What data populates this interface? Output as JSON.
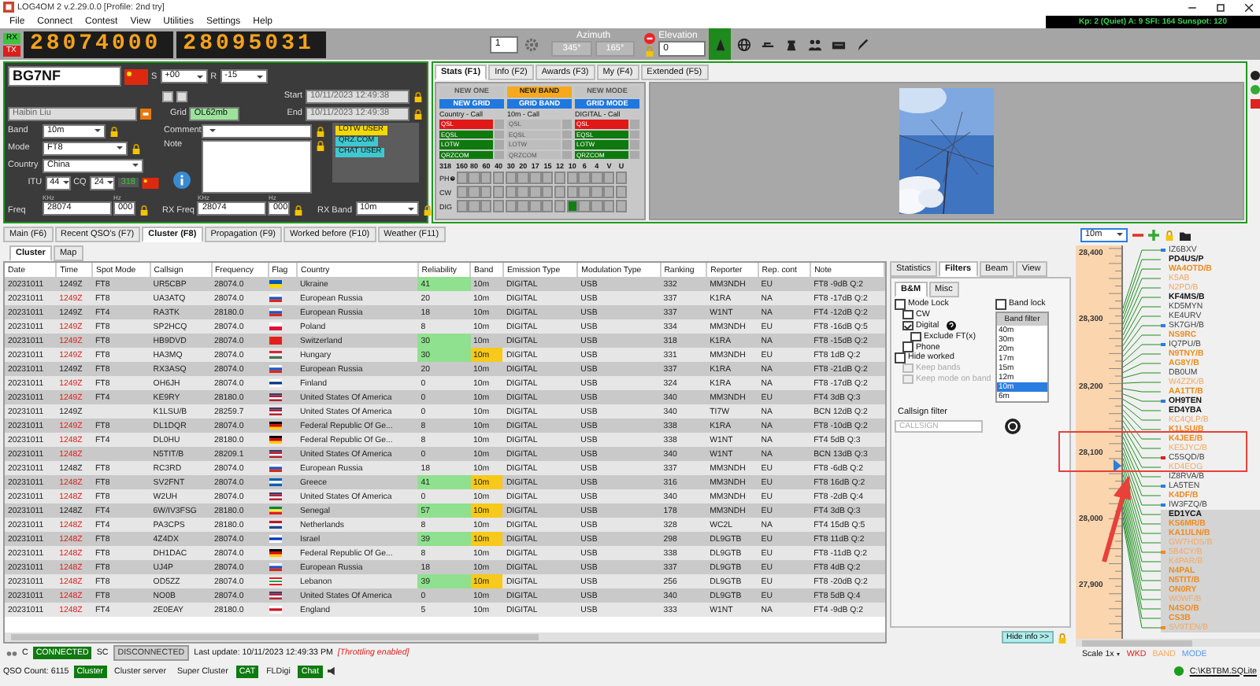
{
  "window": {
    "title": "LOG4OM 2 v.2.29.0.0 [Profile: 2nd try]"
  },
  "menu": [
    "File",
    "Connect",
    "Contest",
    "View",
    "Utilities",
    "Settings",
    "Help"
  ],
  "solar": "Kp: 2 (Quiet)  A: 9  SFI: 164  Sunspot: 120",
  "radio": {
    "rx": "RX",
    "tx": "TX",
    "vfo_a": "28074000",
    "vfo_b": "28095031",
    "spin": "1",
    "azimuth_label": "Azimuth",
    "azimuth": [
      "345°",
      "165°"
    ],
    "elevation_label": "Elevation",
    "elevation": "0"
  },
  "entry": {
    "callsign": "BG7NF",
    "s_label": "S",
    "s_value": "+00",
    "r_label": "R",
    "r_value": "-15",
    "name": "Haibin Liu",
    "grid_label": "Grid",
    "grid": "OL62mb",
    "start_label": "Start",
    "start": "10/11/2023 12:49:38",
    "end_label": "End",
    "end": "10/11/2023 12:49:38",
    "band_label": "Band",
    "band": "10m",
    "mode_label": "Mode",
    "mode": "FT8",
    "country_label": "Country",
    "country": "China",
    "itu_label": "ITU",
    "itu": "44",
    "cq_label": "CQ",
    "cq": "24",
    "dxcc": "318",
    "comment_label": "Comment",
    "note_label": "Note",
    "tags": [
      {
        "label": "LOTW USER",
        "color": "#f5d800"
      },
      {
        "label": "QRZ.COM",
        "color": "#40c8d0"
      },
      {
        "label": "CHAT USER",
        "color": "#40c8d0"
      }
    ],
    "khz": "KHz",
    "hz": "Hz",
    "freq_label": "Freq",
    "freq": "28074",
    "freq_hz": "000",
    "rx_khz": "KHz",
    "rx_hz": "Hz",
    "rx_freq_label": "RX Freq",
    "rx_freq": "28074",
    "rx_freq_hz": "000",
    "rx_band_label": "RX Band",
    "rx_band": "10m"
  },
  "stats": {
    "tabs": [
      {
        "label": "Stats (F1)",
        "selected": true
      },
      {
        "label": "Info (F2)",
        "selected": false
      },
      {
        "label": "Awards (F3)",
        "selected": false
      },
      {
        "label": "My (F4)",
        "selected": false
      },
      {
        "label": "Extended (F5)",
        "selected": false
      }
    ],
    "alerts": [
      {
        "label": "NEW ONE",
        "on": false
      },
      {
        "label": "NEW BAND",
        "on": true
      },
      {
        "label": "NEW MODE",
        "on": false
      }
    ],
    "grid_alerts": [
      {
        "label": "NEW GRID",
        "on": true
      },
      {
        "label": "GRID BAND",
        "on": true
      },
      {
        "label": "GRID MODE",
        "on": true
      }
    ],
    "columns": [
      {
        "title": "Country - Call",
        "items": [
          {
            "label": "QSL",
            "confirmed": false,
            "disabled": false
          },
          {
            "label": "EQSL",
            "confirmed": true,
            "disabled": false
          },
          {
            "label": "LOTW",
            "confirmed": true,
            "disabled": false
          },
          {
            "label": "QRZCOM",
            "confirmed": true,
            "disabled": false
          }
        ]
      },
      {
        "title": "10m - Call",
        "items": [
          {
            "label": "QSL",
            "disabled": true
          },
          {
            "label": "EQSL",
            "disabled": true
          },
          {
            "label": "LOTW",
            "disabled": true
          },
          {
            "label": "QRZCOM",
            "disabled": true
          }
        ]
      },
      {
        "title": "DIGITAL - Call",
        "items": [
          {
            "label": "QSL",
            "confirmed": false,
            "disabled": false
          },
          {
            "label": "EQSL",
            "confirmed": true,
            "disabled": false
          },
          {
            "label": "LOTW",
            "confirmed": true,
            "disabled": false
          },
          {
            "label": "QRZCOM",
            "confirmed": true,
            "disabled": false
          }
        ]
      }
    ],
    "count": "318",
    "bands": [
      "160",
      "80",
      "60",
      "40",
      "30",
      "20",
      "17",
      "15",
      "12",
      "10",
      "6",
      "4",
      "V",
      "U"
    ],
    "modes": [
      {
        "label": "PH",
        "cells": [
          false,
          false,
          false,
          false,
          false,
          false,
          false,
          false,
          false,
          false,
          false,
          false,
          false,
          false
        ]
      },
      {
        "label": "CW",
        "cells": [
          false,
          false,
          false,
          false,
          false,
          false,
          false,
          false,
          false,
          false,
          false,
          false,
          false,
          false
        ]
      },
      {
        "label": "DIG",
        "cells": [
          false,
          false,
          false,
          false,
          false,
          false,
          false,
          false,
          false,
          true,
          false,
          false,
          false,
          false
        ]
      }
    ]
  },
  "main_tabs": [
    {
      "label": "Main (F6)",
      "selected": false
    },
    {
      "label": "Recent QSO's (F7)",
      "selected": false
    },
    {
      "label": "Cluster (F8)",
      "selected": true
    },
    {
      "label": "Propagation (F9)",
      "selected": false
    },
    {
      "label": "Worked before (F10)",
      "selected": false
    },
    {
      "label": "Weather (F11)",
      "selected": false
    }
  ],
  "sub_tabs": [
    {
      "label": "Cluster",
      "selected": true
    },
    {
      "label": "Map",
      "selected": false
    }
  ],
  "table": {
    "columns": [
      "Date",
      "Time",
      "Spot Mode",
      "Callsign",
      "Frequency",
      "Flag",
      "Country",
      "Reliability",
      "Band",
      "Emission Type",
      "Modulation Type",
      "Ranking",
      "Reporter",
      "Rep. cont",
      "Note"
    ],
    "rows": [
      {
        "date": "20231011",
        "time": "1249Z",
        "time_new": false,
        "mode": "FT8",
        "call": "UR5CBP",
        "freq": "28074.0",
        "flag": [
          {
            "color": "#0057b7"
          },
          {
            "color": "#ffd700"
          }
        ],
        "country": "Ukraine",
        "rel": "41",
        "reliable": true,
        "band": "10m",
        "band_new": false,
        "emission": "DIGITAL",
        "modulation": "USB",
        "rank": "332",
        "reporter": "MM3NDH",
        "cont": "EU",
        "note": "FT8 -9dB Q:2"
      },
      {
        "date": "20231011",
        "time": "1249Z",
        "time_new": true,
        "mode": "FT8",
        "call": "UA3ATQ",
        "freq": "28074.0",
        "flag": [
          {
            "color": "#ffffff"
          },
          {
            "color": "#1c57c8"
          },
          {
            "color": "#d52b1e"
          }
        ],
        "country": "European Russia",
        "rel": "20",
        "reliable": false,
        "band": "10m",
        "band_new": false,
        "emission": "DIGITAL",
        "modulation": "USB",
        "rank": "337",
        "reporter": "K1RA",
        "cont": "NA",
        "note": "FT8 -17dB Q:2"
      },
      {
        "date": "20231011",
        "time": "1249Z",
        "time_new": false,
        "mode": "FT4",
        "call": "RA3TK",
        "freq": "28180.0",
        "flag": [
          {
            "color": "#ffffff"
          },
          {
            "color": "#1c57c8"
          },
          {
            "color": "#d52b1e"
          }
        ],
        "country": "European Russia",
        "rel": "18",
        "reliable": false,
        "band": "10m",
        "band_new": false,
        "emission": "DIGITAL",
        "modulation": "USB",
        "rank": "337",
        "reporter": "W1NT",
        "cont": "NA",
        "note": "FT4 -12dB Q:2"
      },
      {
        "date": "20231011",
        "time": "1249Z",
        "time_new": true,
        "mode": "FT8",
        "call": "SP2HCQ",
        "freq": "28074.0",
        "flag": [
          {
            "color": "#ffffff"
          },
          {
            "color": "#dc143c"
          }
        ],
        "country": "Poland",
        "rel": "8",
        "reliable": false,
        "band": "10m",
        "band_new": false,
        "emission": "DIGITAL",
        "modulation": "USB",
        "rank": "334",
        "reporter": "MM3NDH",
        "cont": "EU",
        "note": "FT8 -16dB Q:5"
      },
      {
        "date": "20231011",
        "time": "1249Z",
        "time_new": true,
        "mode": "FT8",
        "call": "HB9DVD",
        "freq": "28074.0",
        "flag": [
          {
            "color": "#e2211c"
          }
        ],
        "country": "Switzerland",
        "rel": "30",
        "reliable": true,
        "band": "10m",
        "band_new": false,
        "emission": "DIGITAL",
        "modulation": "USB",
        "rank": "318",
        "reporter": "K1RA",
        "cont": "NA",
        "note": "FT8 -15dB Q:2"
      },
      {
        "date": "20231011",
        "time": "1249Z",
        "time_new": true,
        "mode": "FT8",
        "call": "HA3MQ",
        "freq": "28074.0",
        "flag": [
          {
            "color": "#ce2939"
          },
          {
            "color": "#ffffff"
          },
          {
            "color": "#477050"
          }
        ],
        "country": "Hungary",
        "rel": "30",
        "reliable": true,
        "band": "10m",
        "band_new": true,
        "emission": "DIGITAL",
        "modulation": "USB",
        "rank": "331",
        "reporter": "MM3NDH",
        "cont": "EU",
        "note": "FT8 1dB Q:2"
      },
      {
        "date": "20231011",
        "time": "1249Z",
        "time_new": false,
        "mode": "FT8",
        "call": "RX3ASQ",
        "freq": "28074.0",
        "flag": [
          {
            "color": "#ffffff"
          },
          {
            "color": "#1c57c8"
          },
          {
            "color": "#d52b1e"
          }
        ],
        "country": "European Russia",
        "rel": "20",
        "reliable": false,
        "band": "10m",
        "band_new": false,
        "emission": "DIGITAL",
        "modulation": "USB",
        "rank": "337",
        "reporter": "K1RA",
        "cont": "NA",
        "note": "FT8 -21dB Q:2"
      },
      {
        "date": "20231011",
        "time": "1249Z",
        "time_new": true,
        "mode": "FT8",
        "call": "OH6JH",
        "freq": "28074.0",
        "flag": [
          {
            "color": "#ffffff"
          },
          {
            "color": "#003580"
          },
          {
            "color": "#ffffff"
          }
        ],
        "country": "Finland",
        "rel": "0",
        "reliable": false,
        "band": "10m",
        "band_new": false,
        "emission": "DIGITAL",
        "modulation": "USB",
        "rank": "324",
        "reporter": "K1RA",
        "cont": "NA",
        "note": "FT8 -17dB Q:2"
      },
      {
        "date": "20231011",
        "time": "1249Z",
        "time_new": true,
        "mode": "FT4",
        "call": "KE9RY",
        "freq": "28180.0",
        "flag": [
          {
            "color": "#3c3b6e"
          },
          {
            "color": "#b22234"
          },
          {
            "color": "#ffffff"
          },
          {
            "color": "#b22234"
          }
        ],
        "country": "United States Of America",
        "rel": "0",
        "reliable": false,
        "band": "10m",
        "band_new": false,
        "emission": "DIGITAL",
        "modulation": "USB",
        "rank": "340",
        "reporter": "MM3NDH",
        "cont": "EU",
        "note": "FT4 3dB Q:3"
      },
      {
        "date": "20231011",
        "time": "1249Z",
        "time_new": false,
        "mode": "",
        "call": "K1LSU/B",
        "freq": "28259.7",
        "flag": [
          {
            "color": "#3c3b6e"
          },
          {
            "color": "#b22234"
          },
          {
            "color": "#ffffff"
          },
          {
            "color": "#b22234"
          }
        ],
        "country": "United States Of America",
        "rel": "0",
        "reliable": false,
        "band": "10m",
        "band_new": false,
        "emission": "DIGITAL",
        "modulation": "USB",
        "rank": "340",
        "reporter": "TI7W",
        "cont": "NA",
        "note": "BCN 12dB Q:2"
      },
      {
        "date": "20231011",
        "time": "1249Z",
        "time_new": true,
        "mode": "FT8",
        "call": "DL1DQR",
        "freq": "28074.0",
        "flag": [
          {
            "color": "#000000"
          },
          {
            "color": "#dd0000"
          },
          {
            "color": "#ffce00"
          }
        ],
        "country": "Federal Republic Of Ge...",
        "rel": "8",
        "reliable": false,
        "band": "10m",
        "band_new": false,
        "emission": "DIGITAL",
        "modulation": "USB",
        "rank": "338",
        "reporter": "K1RA",
        "cont": "NA",
        "note": "FT8 -10dB Q:2"
      },
      {
        "date": "20231011",
        "time": "1248Z",
        "time_new": true,
        "mode": "FT4",
        "call": "DL0HU",
        "freq": "28180.0",
        "flag": [
          {
            "color": "#000000"
          },
          {
            "color": "#dd0000"
          },
          {
            "color": "#ffce00"
          }
        ],
        "country": "Federal Republic Of Ge...",
        "rel": "8",
        "reliable": false,
        "band": "10m",
        "band_new": false,
        "emission": "DIGITAL",
        "modulation": "USB",
        "rank": "338",
        "reporter": "W1NT",
        "cont": "NA",
        "note": "FT4 5dB Q:3"
      },
      {
        "date": "20231011",
        "time": "1248Z",
        "time_new": true,
        "mode": "",
        "call": "N5TIT/B",
        "freq": "28209.1",
        "flag": [
          {
            "color": "#3c3b6e"
          },
          {
            "color": "#b22234"
          },
          {
            "color": "#ffffff"
          },
          {
            "color": "#b22234"
          }
        ],
        "country": "United States Of America",
        "rel": "0",
        "reliable": false,
        "band": "10m",
        "band_new": false,
        "emission": "DIGITAL",
        "modulation": "USB",
        "rank": "340",
        "reporter": "W1NT",
        "cont": "NA",
        "note": "BCN 13dB Q:3"
      },
      {
        "date": "20231011",
        "time": "1248Z",
        "time_new": false,
        "mode": "FT8",
        "call": "RC3RD",
        "freq": "28074.0",
        "flag": [
          {
            "color": "#ffffff"
          },
          {
            "color": "#1c57c8"
          },
          {
            "color": "#d52b1e"
          }
        ],
        "country": "European Russia",
        "rel": "18",
        "reliable": false,
        "band": "10m",
        "band_new": false,
        "emission": "DIGITAL",
        "modulation": "USB",
        "rank": "337",
        "reporter": "MM3NDH",
        "cont": "EU",
        "note": "FT8 -6dB Q:2"
      },
      {
        "date": "20231011",
        "time": "1248Z",
        "time_new": true,
        "mode": "FT8",
        "call": "SV2FNT",
        "freq": "28074.0",
        "flag": [
          {
            "color": "#0d5eaf"
          },
          {
            "color": "#ffffff"
          },
          {
            "color": "#0d5eaf"
          }
        ],
        "country": "Greece",
        "rel": "41",
        "reliable": true,
        "band": "10m",
        "band_new": true,
        "emission": "DIGITAL",
        "modulation": "USB",
        "rank": "316",
        "reporter": "MM3NDH",
        "cont": "EU",
        "note": "FT8 16dB Q:2"
      },
      {
        "date": "20231011",
        "time": "1248Z",
        "time_new": true,
        "mode": "FT8",
        "call": "W2UH",
        "freq": "28074.0",
        "flag": [
          {
            "color": "#3c3b6e"
          },
          {
            "color": "#b22234"
          },
          {
            "color": "#ffffff"
          },
          {
            "color": "#b22234"
          }
        ],
        "country": "United States Of America",
        "rel": "0",
        "reliable": false,
        "band": "10m",
        "band_new": false,
        "emission": "DIGITAL",
        "modulation": "USB",
        "rank": "340",
        "reporter": "MM3NDH",
        "cont": "EU",
        "note": "FT8 -2dB Q:4"
      },
      {
        "date": "20231011",
        "time": "1248Z",
        "time_new": false,
        "mode": "FT4",
        "call": "6W/IV3FSG",
        "freq": "28180.0",
        "flag": [
          {
            "color": "#00853f"
          },
          {
            "color": "#fdef42"
          },
          {
            "color": "#e31b23"
          }
        ],
        "country": "Senegal",
        "rel": "57",
        "reliable": true,
        "band": "10m",
        "band_new": true,
        "emission": "DIGITAL",
        "modulation": "USB",
        "rank": "178",
        "reporter": "MM3NDH",
        "cont": "EU",
        "note": "FT4 3dB Q:3"
      },
      {
        "date": "20231011",
        "time": "1248Z",
        "time_new": true,
        "mode": "FT4",
        "call": "PA3CPS",
        "freq": "28180.0",
        "flag": [
          {
            "color": "#ae1c28"
          },
          {
            "color": "#ffffff"
          },
          {
            "color": "#21468b"
          }
        ],
        "country": "Netherlands",
        "rel": "8",
        "reliable": false,
        "band": "10m",
        "band_new": false,
        "emission": "DIGITAL",
        "modulation": "USB",
        "rank": "328",
        "reporter": "WC2L",
        "cont": "NA",
        "note": "FT4 15dB Q:5"
      },
      {
        "date": "20231011",
        "time": "1248Z",
        "time_new": true,
        "mode": "FT8",
        "call": "4Z4DX",
        "freq": "28074.0",
        "flag": [
          {
            "color": "#ffffff"
          },
          {
            "color": "#0038b8"
          },
          {
            "color": "#ffffff"
          }
        ],
        "country": "Israel",
        "rel": "39",
        "reliable": true,
        "band": "10m",
        "band_new": true,
        "emission": "DIGITAL",
        "modulation": "USB",
        "rank": "298",
        "reporter": "DL9GTB",
        "cont": "EU",
        "note": "FT8 11dB Q:2"
      },
      {
        "date": "20231011",
        "time": "1248Z",
        "time_new": true,
        "mode": "FT8",
        "call": "DH1DAC",
        "freq": "28074.0",
        "flag": [
          {
            "color": "#000000"
          },
          {
            "color": "#dd0000"
          },
          {
            "color": "#ffce00"
          }
        ],
        "country": "Federal Republic Of Ge...",
        "rel": "8",
        "reliable": false,
        "band": "10m",
        "band_new": false,
        "emission": "DIGITAL",
        "modulation": "USB",
        "rank": "338",
        "reporter": "DL9GTB",
        "cont": "EU",
        "note": "FT8 -11dB Q:2"
      },
      {
        "date": "20231011",
        "time": "1248Z",
        "time_new": true,
        "mode": "FT8",
        "call": "UJ4P",
        "freq": "28074.0",
        "flag": [
          {
            "color": "#ffffff"
          },
          {
            "color": "#1c57c8"
          },
          {
            "color": "#d52b1e"
          }
        ],
        "country": "European Russia",
        "rel": "18",
        "reliable": false,
        "band": "10m",
        "band_new": false,
        "emission": "DIGITAL",
        "modulation": "USB",
        "rank": "337",
        "reporter": "DL9GTB",
        "cont": "EU",
        "note": "FT8 4dB Q:2"
      },
      {
        "date": "20231011",
        "time": "1248Z",
        "time_new": true,
        "mode": "FT8",
        "call": "OD5ZZ",
        "freq": "28074.0",
        "flag": [
          {
            "color": "#ee161f"
          },
          {
            "color": "#ffffff"
          },
          {
            "color": "#00a651"
          },
          {
            "color": "#ffffff"
          },
          {
            "color": "#ee161f"
          }
        ],
        "country": "Lebanon",
        "rel": "39",
        "reliable": true,
        "band": "10m",
        "band_new": true,
        "emission": "DIGITAL",
        "modulation": "USB",
        "rank": "256",
        "reporter": "DL9GTB",
        "cont": "EU",
        "note": "FT8 -20dB Q:2"
      },
      {
        "date": "20231011",
        "time": "1248Z",
        "time_new": true,
        "mode": "FT8",
        "call": "NO0B",
        "freq": "28074.0",
        "flag": [
          {
            "color": "#3c3b6e"
          },
          {
            "color": "#b22234"
          },
          {
            "color": "#ffffff"
          },
          {
            "color": "#b22234"
          }
        ],
        "country": "United States Of America",
        "rel": "0",
        "reliable": false,
        "band": "10m",
        "band_new": false,
        "emission": "DIGITAL",
        "modulation": "USB",
        "rank": "340",
        "reporter": "DL9GTB",
        "cont": "EU",
        "note": "FT8 5dB Q:4"
      },
      {
        "date": "20231011",
        "time": "1248Z",
        "time_new": true,
        "mode": "FT4",
        "call": "2E0EAY",
        "freq": "28180.0",
        "flag": [
          {
            "color": "#ffffff"
          },
          {
            "color": "#ce1124"
          },
          {
            "color": "#ffffff"
          }
        ],
        "country": "England",
        "rel": "5",
        "reliable": false,
        "band": "10m",
        "band_new": false,
        "emission": "DIGITAL",
        "modulation": "USB",
        "rank": "333",
        "reporter": "W1NT",
        "cont": "NA",
        "note": "FT4 -9dB Q:2"
      }
    ]
  },
  "filters": {
    "tabs": [
      {
        "label": "Statistics",
        "selected": false
      },
      {
        "label": "Filters",
        "selected": true
      },
      {
        "label": "Beam",
        "selected": false
      },
      {
        "label": "View",
        "selected": false
      }
    ],
    "sub_tabs": [
      {
        "label": "B&M",
        "selected": true
      },
      {
        "label": "Misc",
        "selected": false
      }
    ],
    "options": [
      {
        "label": "Mode Lock",
        "checked": false,
        "disabled": false,
        "children": [
          {
            "label": "CW",
            "checked": false,
            "disabled": false
          },
          {
            "label": "Digital",
            "checked": true,
            "disabled": false,
            "children": [
              {
                "label": "Exclude FT(x)",
                "checked": false,
                "disabled": false
              }
            ]
          },
          {
            "label": "Phone",
            "checked": false,
            "disabled": false
          }
        ]
      },
      {
        "label": "Hide worked",
        "checked": false,
        "disabled": false,
        "children": [
          {
            "label": "Keep bands",
            "checked": false,
            "disabled": true
          },
          {
            "label": "Keep mode on band",
            "checked": false,
            "disabled": true
          }
        ]
      }
    ],
    "band_lock": {
      "label": "Band lock",
      "checked": false
    },
    "band_filter": {
      "title": "Band filter",
      "items": [
        {
          "label": "40m",
          "selected": false
        },
        {
          "label": "30m",
          "selected": false
        },
        {
          "label": "20m",
          "selected": false
        },
        {
          "label": "17m",
          "selected": false
        },
        {
          "label": "15m",
          "selected": false
        },
        {
          "label": "12m",
          "selected": false
        },
        {
          "label": "10m",
          "selected": true
        },
        {
          "label": "6m",
          "selected": false
        }
      ]
    },
    "callsign_label": "Callsign filter",
    "callsign_placeholder": "CALLSIGN",
    "hide_info": "Hide info >>"
  },
  "band_map": {
    "band": "10m",
    "scale": [
      "28,400",
      "28,300",
      "28,200",
      "28,100",
      "28,000",
      "27,900"
    ],
    "spots": [
      {
        "call": "IZ6BXV",
        "color": "#444444",
        "bold": false,
        "shaded": false,
        "marker": {
          "color": "#2a7de1"
        }
      },
      {
        "call": "PD4US/P",
        "color": "#111111",
        "bold": true,
        "shaded": false
      },
      {
        "call": "WA4OTD/B",
        "color": "#f08a1c",
        "bold": true,
        "shaded": false
      },
      {
        "call": "K5AB",
        "color": "#f5a860",
        "bold": false,
        "shaded": false
      },
      {
        "call": "N2PD/B",
        "color": "#f5a860",
        "bold": false,
        "shaded": false
      },
      {
        "call": "KF4MS/B",
        "color": "#111111",
        "bold": true,
        "shaded": false
      },
      {
        "call": "KD5MYN",
        "color": "#444444",
        "bold": false,
        "shaded": false
      },
      {
        "call": "KE4URV",
        "color": "#444444",
        "bold": false,
        "shaded": false
      },
      {
        "call": "SK7GH/B",
        "color": "#444444",
        "bold": false,
        "shaded": false,
        "marker": {
          "color": "#2a7de1"
        }
      },
      {
        "call": "NS9RC",
        "color": "#f08a1c",
        "bold": true,
        "shaded": false
      },
      {
        "call": "IQ7PU/B",
        "color": "#444444",
        "bold": false,
        "shaded": false,
        "marker": {
          "color": "#2a7de1"
        }
      },
      {
        "call": "N9TNY/B",
        "color": "#f08a1c",
        "bold": true,
        "shaded": false
      },
      {
        "call": "AG8Y/B",
        "color": "#f08a1c",
        "bold": true,
        "shaded": false
      },
      {
        "call": "DB0UM",
        "color": "#444444",
        "bold": false,
        "shaded": false
      },
      {
        "call": "W4ZZK/B",
        "color": "#f5a860",
        "bold": false,
        "shaded": false
      },
      {
        "call": "AA1TT/B",
        "color": "#f08a1c",
        "bold": true,
        "shaded": false
      },
      {
        "call": "OH9TEN",
        "color": "#111111",
        "bold": true,
        "shaded": false,
        "marker": {
          "color": "#2a7de1"
        }
      },
      {
        "call": "ED4YBA",
        "color": "#111111",
        "bold": true,
        "shaded": false
      },
      {
        "call": "KC4QLP/B",
        "color": "#f5a860",
        "bold": false,
        "shaded": false
      },
      {
        "call": "K1LSU/B",
        "color": "#f08a1c",
        "bold": true,
        "shaded": false
      },
      {
        "call": "K4JEE/B",
        "color": "#f08a1c",
        "bold": true,
        "shaded": false
      },
      {
        "call": "KE5JYC/B",
        "color": "#f5a860",
        "bold": false,
        "shaded": false
      },
      {
        "call": "C5SQD/B",
        "color": "#444444",
        "bold": false,
        "shaded": false,
        "marker": {
          "color": "#e02020"
        }
      },
      {
        "call": "KD4EOG",
        "color": "#f5a860",
        "bold": false,
        "shaded": false
      },
      {
        "call": "IZ8RVA/B",
        "color": "#444444",
        "bold": false,
        "shaded": false
      },
      {
        "call": "LA5TEN",
        "color": "#444444",
        "bold": false,
        "shaded": false,
        "marker": {
          "color": "#2a7de1"
        }
      },
      {
        "call": "K4DF/B",
        "color": "#f08a1c",
        "bold": true,
        "shaded": false
      },
      {
        "call": "IW3FZQ/B",
        "color": "#444444",
        "bold": false,
        "shaded": false,
        "marker": {
          "color": "#2a7de1"
        }
      },
      {
        "call": "ED1YCA",
        "color": "#111111",
        "bold": true,
        "shaded": true
      },
      {
        "call": "KS6MR/B",
        "color": "#f08a1c",
        "bold": true,
        "shaded": true
      },
      {
        "call": "KA1ULN/B",
        "color": "#f08a1c",
        "bold": true,
        "shaded": true
      },
      {
        "call": "GW7HDS/B",
        "color": "#f5a860",
        "bold": false,
        "shaded": true
      },
      {
        "call": "5B4CY/B",
        "color": "#f5a860",
        "bold": false,
        "shaded": true,
        "marker": {
          "color": "#f08a1c"
        }
      },
      {
        "call": "K4PAR/B",
        "color": "#f5a860",
        "bold": false,
        "shaded": true
      },
      {
        "call": "N4PAL",
        "color": "#f08a1c",
        "bold": true,
        "shaded": true
      },
      {
        "call": "N5TIT/B",
        "color": "#f08a1c",
        "bold": true,
        "shaded": true
      },
      {
        "call": "ON0RY",
        "color": "#f08a1c",
        "bold": true,
        "shaded": true
      },
      {
        "call": "W0WF/B",
        "color": "#f5a860",
        "bold": false,
        "shaded": true
      },
      {
        "call": "N4SO/B",
        "color": "#f08a1c",
        "bold": true,
        "shaded": true
      },
      {
        "call": "CS3B",
        "color": "#f08a1c",
        "bold": true,
        "shaded": true
      },
      {
        "call": "SV9TEN/B",
        "color": "#f5a860",
        "bold": false,
        "shaded": true,
        "marker": {
          "color": "#f08a1c"
        }
      }
    ],
    "scale_label": "Scale 1x",
    "legend": [
      {
        "label": "WKD",
        "color": "#e02020"
      },
      {
        "label": "BAND",
        "color": "#f5a860"
      },
      {
        "label": "MODE",
        "color": "#5599ee"
      }
    ],
    "database": "C:\\KBTBM.SQLite"
  },
  "connection": {
    "items": [
      {
        "label": "C",
        "kind": "label"
      },
      {
        "label": "CONNECTED",
        "kind": "chip",
        "connected": true
      },
      {
        "label": "SC",
        "kind": "label"
      },
      {
        "label": "DISCONNECTED",
        "kind": "chip",
        "connected": false
      }
    ],
    "last_update": "Last update: 10/11/2023 12:49:33 PM",
    "throttling": "[Throttling enabled]"
  },
  "status_bar": {
    "qso_count": "QSO Count: 6115",
    "services": [
      {
        "label": "Cluster",
        "active": true
      },
      {
        "label": "Cluster server",
        "active": false
      },
      {
        "label": "Super Cluster",
        "active": false
      },
      {
        "label": "CAT",
        "active": true
      },
      {
        "label": "FLDigi",
        "active": false
      },
      {
        "label": "Chat",
        "active": true
      }
    ]
  }
}
